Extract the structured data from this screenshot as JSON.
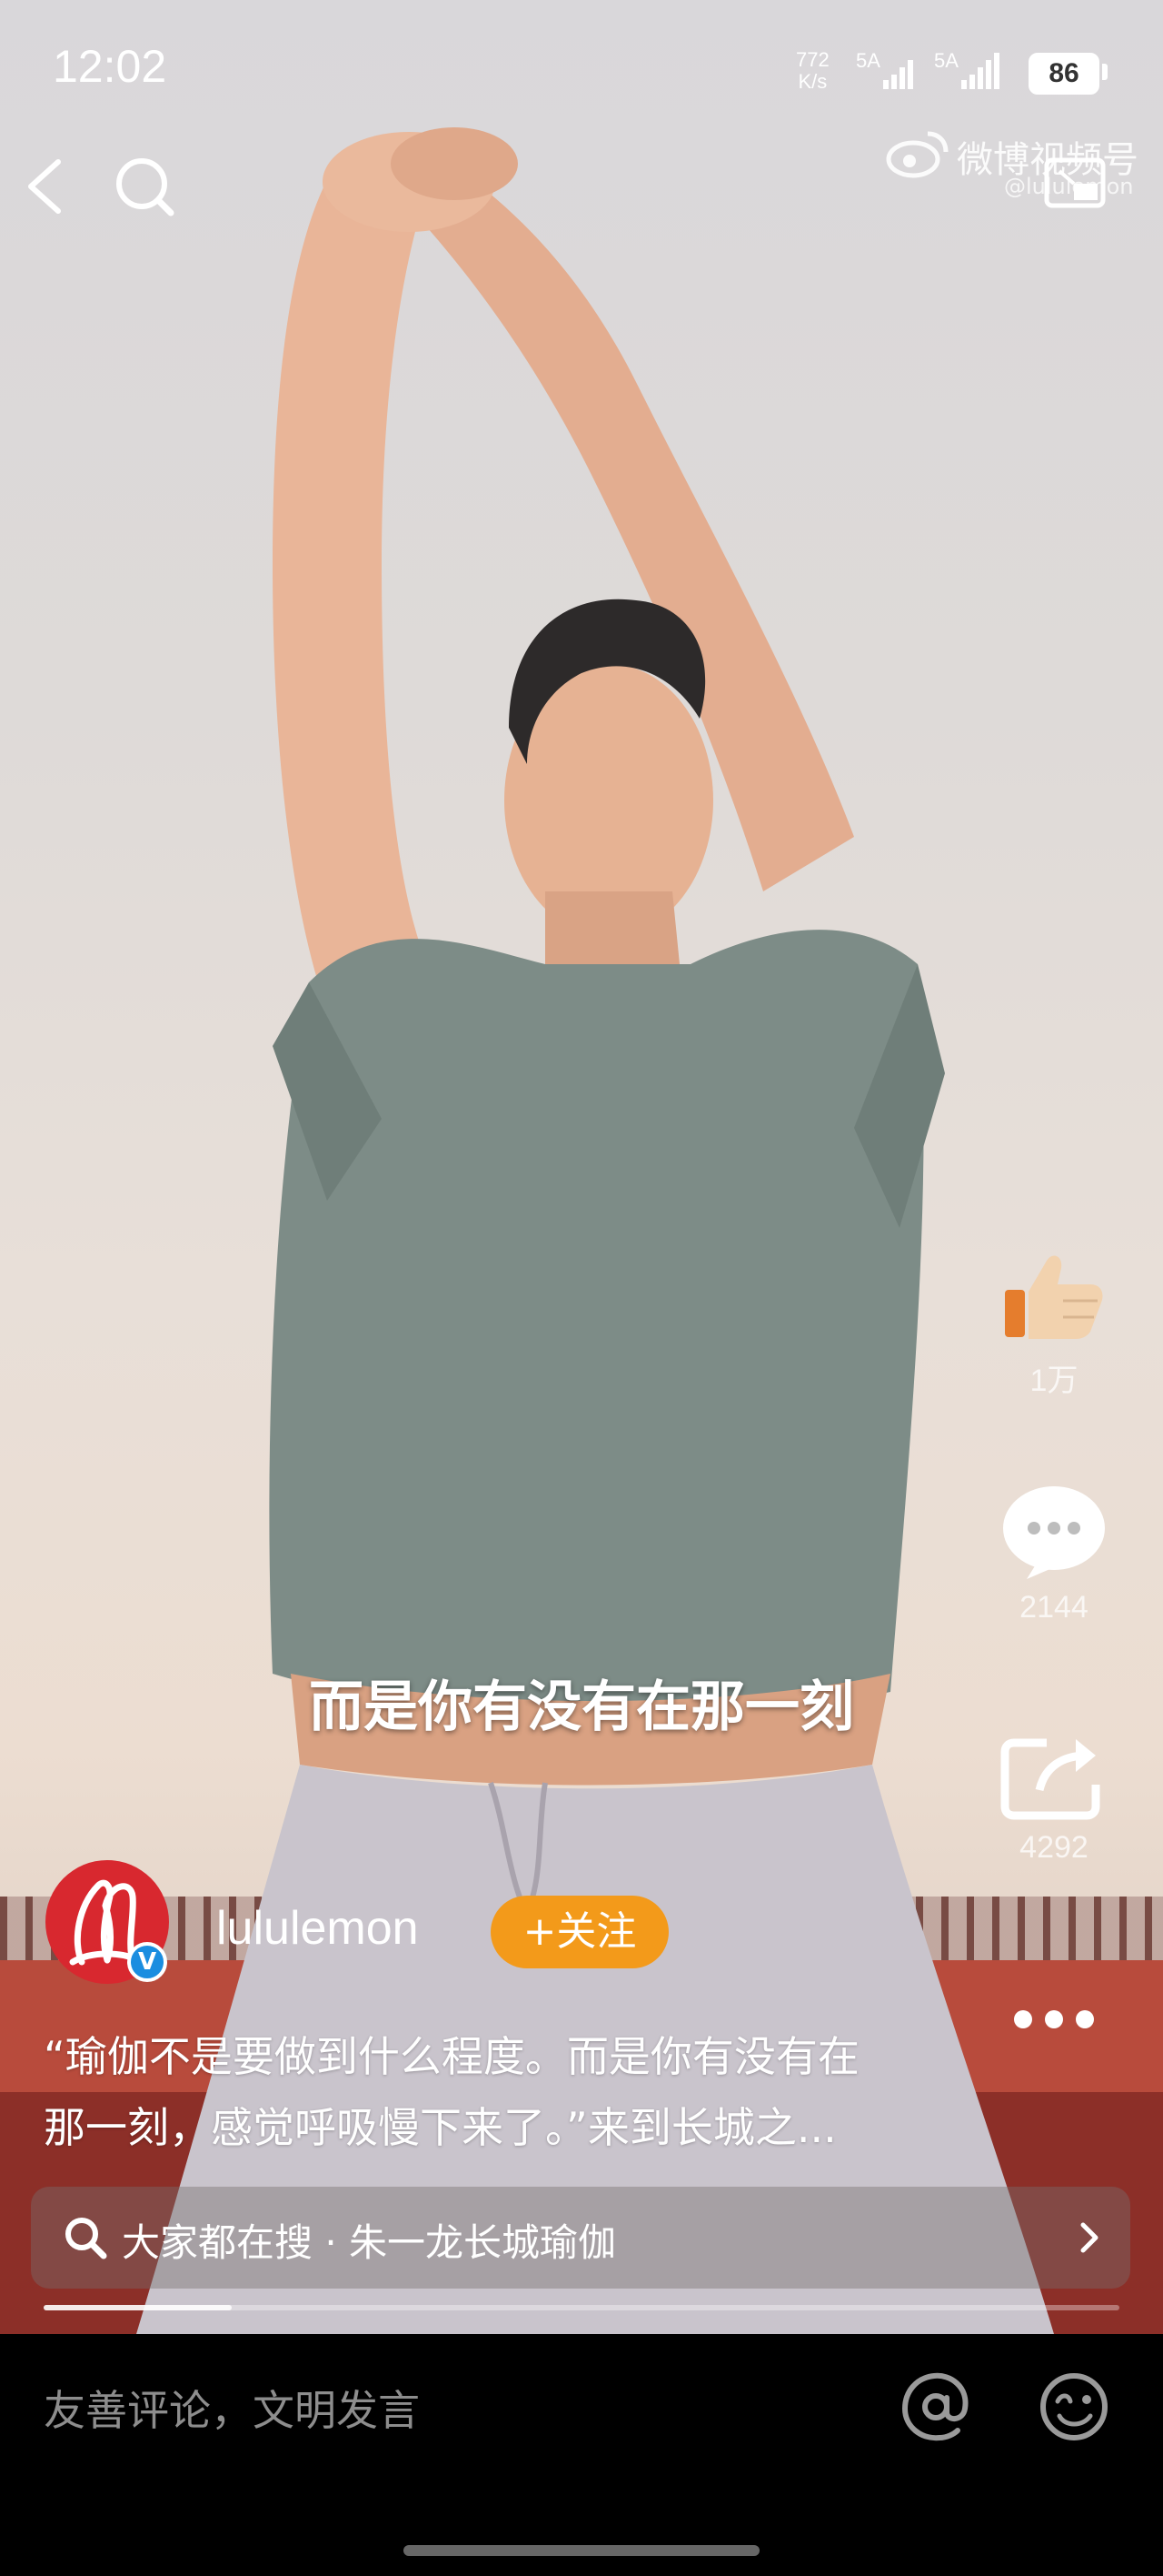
{
  "status_bar": {
    "time": "12:02",
    "net_speed": "772",
    "net_unit": "K/s",
    "sim1": "5A",
    "sim2": "5A",
    "battery": "86"
  },
  "watermark": {
    "brand": "微博视频号",
    "handle": "@lululemon"
  },
  "subtitle": "而是你有没有在那一刻",
  "actions": {
    "likes": "1万",
    "comments": "2144",
    "shares": "4292"
  },
  "author": {
    "name": "lululemon",
    "follow_label": "+关注",
    "verified_mark": "V"
  },
  "caption": {
    "line1": "“瑜伽不是要做到什么程度。而是你有没有在",
    "line2": "那一刻，感觉呼吸慢下来了。”来到长城之..."
  },
  "search": {
    "text": "大家都在搜 · 朱一龙长城瑜伽"
  },
  "playback": {
    "progress": 0.175
  },
  "comment_bar": {
    "placeholder": "友善评论，文明发言"
  },
  "icons": [
    "back-arrow-icon",
    "search-icon",
    "weibo-logo-icon",
    "pip-icon",
    "thumbs-up-icon",
    "comment-bubble-icon",
    "share-icon",
    "more-dots-icon",
    "chevron-right-icon",
    "at-icon",
    "emoji-icon"
  ],
  "colors": {
    "follow": "#f39a1a",
    "avatar": "#d8282f",
    "verified": "#1a8de0"
  }
}
